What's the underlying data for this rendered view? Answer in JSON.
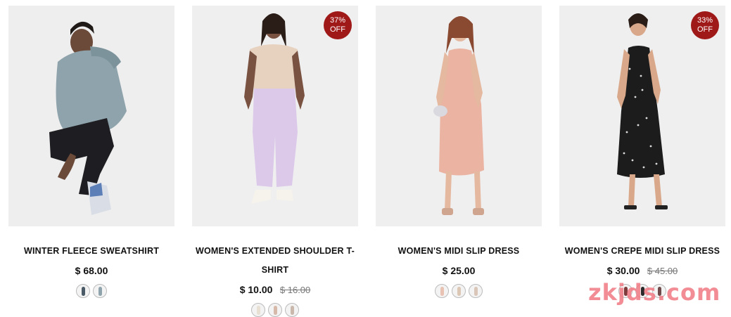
{
  "products": [
    {
      "title": "WINTER FLEECE SWEATSHIRT",
      "price": "$ 68.00",
      "old_price": "",
      "badge": null,
      "swatch_colors": [
        "#4a5a66",
        "#8ea3ab"
      ]
    },
    {
      "title": "WOMEN'S EXTENDED SHOULDER T-SHIRT",
      "price": "$ 10.00",
      "old_price": "$ 16.00",
      "badge": {
        "pct": "37%",
        "label": "OFF"
      },
      "swatch_colors": [
        "#e9e0d4",
        "#d7b9a9",
        "#c9b8ab"
      ]
    },
    {
      "title": "WOMEN'S MIDI SLIP DRESS",
      "price": "$ 25.00",
      "old_price": "",
      "badge": null,
      "swatch_colors": [
        "#e8c2b2",
        "#dcc6b4",
        "#d9c6b8"
      ]
    },
    {
      "title": "WOMEN'S CREPE MIDI SLIP DRESS",
      "price": "$ 30.00",
      "old_price": "$ 45.00",
      "badge": {
        "pct": "33%",
        "label": "OFF"
      },
      "swatch_colors": [
        "#7c3a3a",
        "#2a2a2a",
        "#6e4a4a"
      ]
    }
  ],
  "watermark": "zkjds.com",
  "colors": {
    "badge": "#a01919",
    "image_bg": "#efefef",
    "watermark": "#f07882"
  }
}
